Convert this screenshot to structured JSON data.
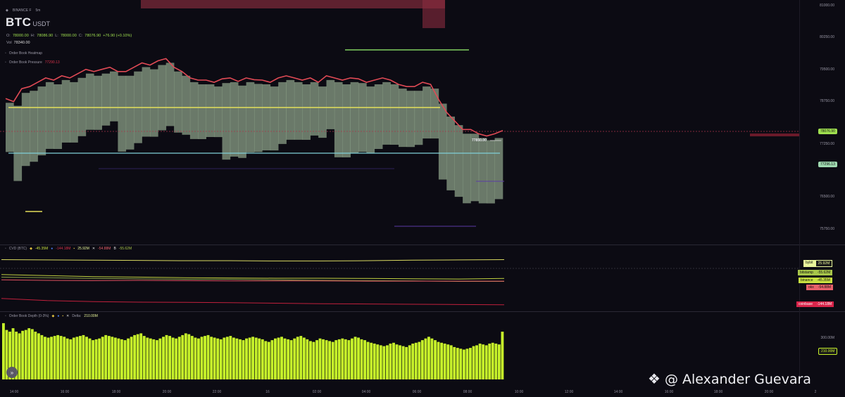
{
  "header": {
    "exchange": "BINANCE F",
    "interval": "5m",
    "symbol": "BTC",
    "quote_asset": "USDT",
    "ohlc": {
      "o_label": "O:",
      "o": "78000.00",
      "h_label": "H:",
      "h": "78086.90",
      "l_label": "L:",
      "l": "78000.00",
      "c_label": "C:",
      "c": "78076.90",
      "change": "+76.90 (+0.10%)"
    },
    "vol_label": "Vol",
    "vol_value": "78340.00"
  },
  "indicators": {
    "heatmap": "Order Book Heatmap",
    "pressure": "Order Book Pressure",
    "pressure_value": "77290.13"
  },
  "price_axis": {
    "ticks": [
      "81000.00",
      "80250.00",
      "79500.00",
      "78750.00",
      "78000.00",
      "77250.00",
      "76500.00",
      "75750.00"
    ],
    "current_price": "78076.90",
    "pressure_tag": "77296.13",
    "level_label": "77850.00"
  },
  "cvd": {
    "label": "CVD (BTC)",
    "v1": "-45.35M",
    "v2": "-144.18M",
    "v3": "25.92M",
    "v4": "-54.88M",
    "v5": "-55.62M",
    "tags": [
      {
        "name": "bybit",
        "value": "25.92M",
        "color": "#e8f59a"
      },
      {
        "name": "bitstamp",
        "value": "-55.62M",
        "color": "#a8c64a"
      },
      {
        "name": "binance",
        "value": "-45.35M",
        "color": "#c8e040"
      },
      {
        "name": "okx",
        "value": "-54.88M",
        "color": "#e8606a"
      },
      {
        "name": "coinbase",
        "value": "-144.18M",
        "color": "#d8244a"
      }
    ],
    "series": [
      {
        "name": "bybit",
        "color": "#d8d860",
        "values": [
          26,
          25,
          24,
          23,
          22,
          22,
          21,
          21,
          22,
          24,
          25,
          26
        ]
      },
      {
        "name": "bitstamp",
        "color": "#8aa048",
        "values": [
          -40,
          -42,
          -45,
          -46,
          -48,
          -48,
          -50,
          -52,
          -53,
          -54,
          -56,
          -56
        ]
      },
      {
        "name": "binance",
        "color": "#c0d040",
        "values": [
          -30,
          -34,
          -38,
          -40,
          -42,
          -43,
          -44,
          -44,
          -45,
          -46,
          -47,
          -45
        ]
      },
      {
        "name": "okx",
        "color": "#e05060",
        "values": [
          -50,
          -52,
          -53,
          -52,
          -53,
          -54,
          -54,
          -54,
          -55,
          -55,
          -55,
          -55
        ]
      },
      {
        "name": "coinbase",
        "color": "#c0203c",
        "values": [
          -120,
          -128,
          -132,
          -134,
          -135,
          -136,
          -138,
          -140,
          -141,
          -142,
          -143,
          -144
        ]
      }
    ]
  },
  "depth": {
    "label": "Order Book Depth (0-3%)",
    "delta_label": "Delta:",
    "delta_value": "210.00M",
    "axis_ticks": [
      "300.00M"
    ],
    "current_tag": "210.00M",
    "bar_color": "#c7f22a",
    "values": [
      330,
      290,
      280,
      300,
      280,
      270,
      285,
      290,
      300,
      295,
      280,
      270,
      260,
      250,
      245,
      250,
      255,
      260,
      255,
      250,
      240,
      235,
      245,
      250,
      255,
      260,
      250,
      240,
      230,
      235,
      240,
      250,
      260,
      255,
      250,
      245,
      240,
      235,
      230,
      240,
      250,
      260,
      265,
      270,
      255,
      245,
      240,
      235,
      230,
      240,
      250,
      260,
      255,
      245,
      240,
      250,
      260,
      270,
      265,
      255,
      245,
      240,
      250,
      255,
      260,
      250,
      245,
      240,
      235,
      245,
      250,
      255,
      245,
      240,
      235,
      230,
      240,
      245,
      250,
      245,
      240,
      235,
      225,
      220,
      230,
      240,
      245,
      250,
      240,
      235,
      230,
      240,
      250,
      255,
      245,
      235,
      225,
      220,
      230,
      240,
      235,
      230,
      225,
      220,
      230,
      235,
      240,
      235,
      230,
      240,
      250,
      245,
      235,
      230,
      220,
      215,
      210,
      205,
      200,
      195,
      200,
      210,
      215,
      205,
      200,
      195,
      190,
      200,
      210,
      215,
      220,
      230,
      240,
      250,
      240,
      230,
      220,
      215,
      210,
      205,
      200,
      190,
      185,
      180,
      175,
      180,
      185,
      195,
      200,
      210,
      205,
      200,
      210,
      215,
      210,
      205,
      280
    ]
  },
  "time_axis": [
    "14:00",
    "16:00",
    "18:00",
    "20:00",
    "22:00",
    "16",
    "02:00",
    "04:00",
    "06:00",
    "08:00",
    "10:00",
    "12:00",
    "14:00",
    "16:00",
    "18:00",
    "20:00",
    "2"
  ],
  "watermark": "@ Alexander Guevara",
  "price_chart": {
    "type": "line",
    "close": [
      78820,
      78750,
      79050,
      79100,
      79200,
      79300,
      79250,
      79350,
      79300,
      79400,
      79500,
      79450,
      79500,
      79550,
      79450,
      79450,
      79550,
      79650,
      79600,
      79700,
      79750,
      79550,
      79450,
      79300,
      79250,
      79250,
      79200,
      79280,
      79300,
      79220,
      79300,
      79260,
      79250,
      79200,
      79300,
      79350,
      79300,
      79250,
      79300,
      79200,
      79350,
      79300,
      79250,
      79300,
      79280,
      79200,
      79250,
      79300,
      79250,
      79150,
      79100,
      79100,
      79200,
      79150,
      78800,
      78500,
      78300,
      78100,
      78100,
      78000,
      77950,
      78000,
      78076
    ]
  }
}
